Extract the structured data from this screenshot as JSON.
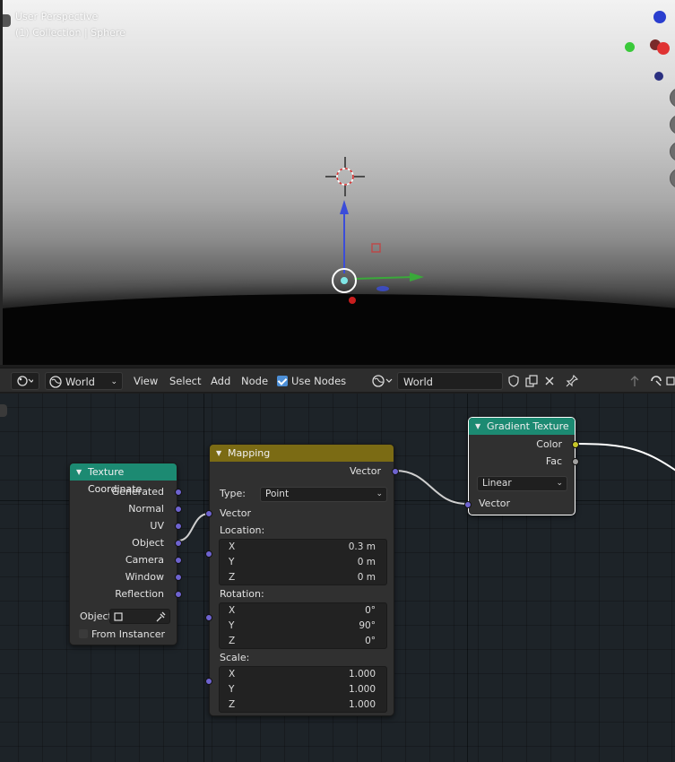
{
  "viewport": {
    "title": "User Perspective",
    "subtitle": "(1) Collection | Sphere",
    "gizmo": {
      "z_label": "Z",
      "x_label": "X"
    }
  },
  "header": {
    "editor_type_icon": "node-editor-icon",
    "shader_type": "World",
    "menus": [
      "View",
      "Select",
      "Add",
      "Node"
    ],
    "use_nodes_label": "Use Nodes",
    "world_name": "World"
  },
  "nodes": {
    "texture_coordinate": {
      "title": "Texture Coordinate",
      "outputs": [
        "Generated",
        "Normal",
        "UV",
        "Object",
        "Camera",
        "Window",
        "Reflection"
      ],
      "object_label": "Object:",
      "from_instancer_label": "From Instancer"
    },
    "mapping": {
      "title": "Mapping",
      "output_label": "Vector",
      "type_label": "Type:",
      "type_value": "Point",
      "vector_input": "Vector",
      "location_label": "Location:",
      "location": [
        {
          "axis": "X",
          "value": "0.3 m"
        },
        {
          "axis": "Y",
          "value": "0 m"
        },
        {
          "axis": "Z",
          "value": "0 m"
        }
      ],
      "rotation_label": "Rotation:",
      "rotation": [
        {
          "axis": "X",
          "value": "0°"
        },
        {
          "axis": "Y",
          "value": "90°"
        },
        {
          "axis": "Z",
          "value": "0°"
        }
      ],
      "scale_label": "Scale:",
      "scale": [
        {
          "axis": "X",
          "value": "1.000"
        },
        {
          "axis": "Y",
          "value": "1.000"
        },
        {
          "axis": "Z",
          "value": "1.000"
        }
      ]
    },
    "gradient_texture": {
      "title": "Gradient Texture",
      "outputs": [
        "Color",
        "Fac"
      ],
      "gradient_type": "Linear",
      "input": "Vector"
    }
  },
  "colors": {
    "node_header_texture": "#1c8a72",
    "node_header_vector": "#7b6b14",
    "socket_vector": "#6e63cf",
    "socket_color": "#c7c729",
    "socket_float": "#a1a1a1",
    "checkbox_accent": "#4d8fd6"
  }
}
